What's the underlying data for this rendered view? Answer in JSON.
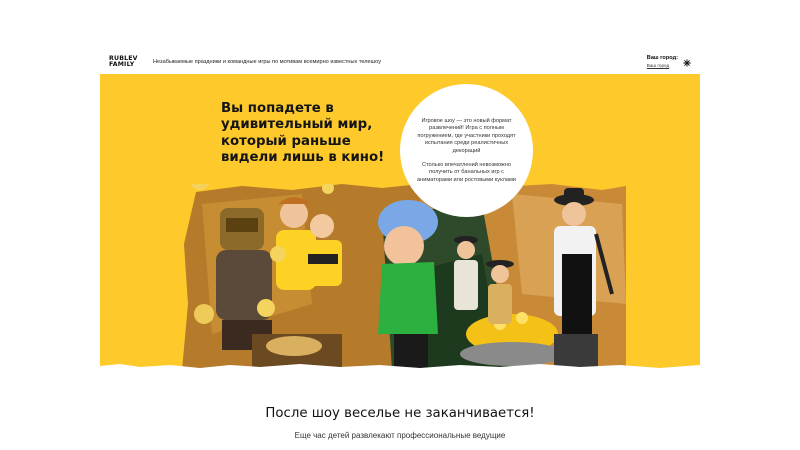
{
  "header": {
    "logo_line1": "RUBLEV",
    "logo_line2": "FAMILY",
    "tagline": "Незабываемые праздники и командные игры по мотивам всемирно известных телешоу",
    "city_label": "Ваш город:",
    "city_value": "Ваш город",
    "city_icon": "snowflake-icon"
  },
  "hero": {
    "title": "Вы попадете в удивительный мир, который раньше видели лишь в кино!",
    "circle_p1": "Игровое шоу — это новый формат развлечений! Игра с полным погружением, где участники проходят испытания среди реалистичных декораций",
    "circle_p2": "Столько впечатлений невозможно получить от банальных игр с аниматорами или ростовыми куклами",
    "background_color": "#fdc92b"
  },
  "after_show": {
    "title": "После шоу веселье не заканчивается!",
    "subtitle": "Еще час детей развлекают профессиональные ведущие"
  }
}
